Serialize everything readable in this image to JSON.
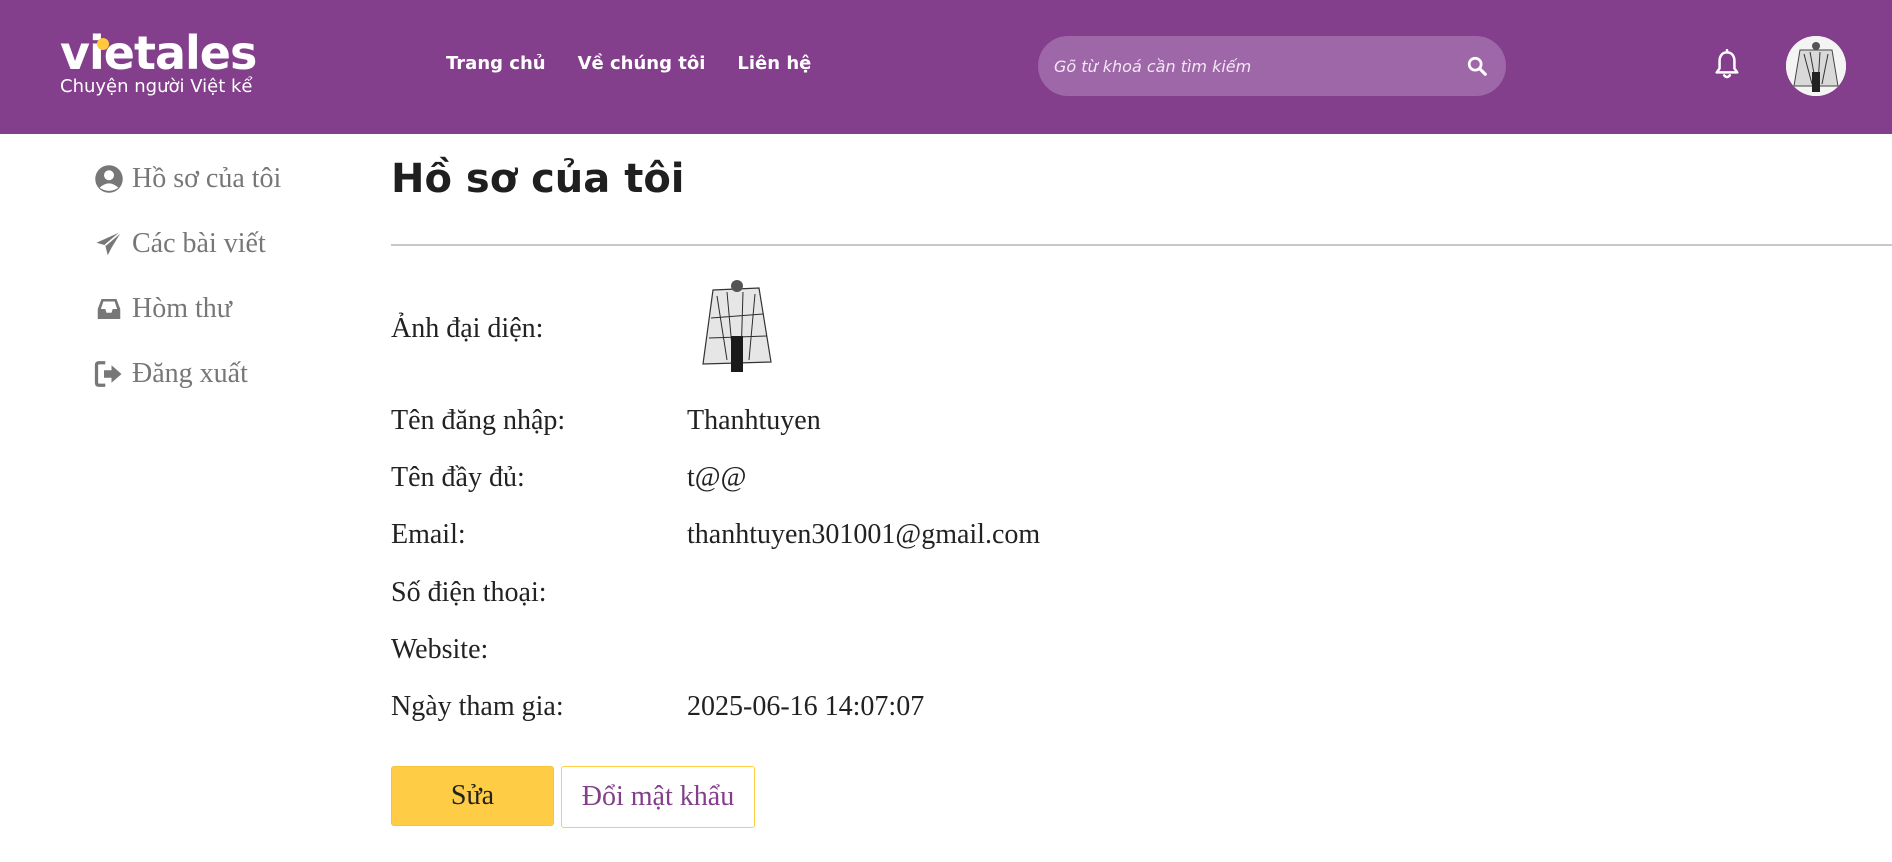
{
  "brand": {
    "logo_text": "vietales",
    "tagline": "Chuyện người Việt kể",
    "accent": "#843f8c",
    "logo_dot": "#ffc93c"
  },
  "nav": [
    {
      "label": "Trang chủ"
    },
    {
      "label": "Về chúng tôi"
    },
    {
      "label": "Liên hệ"
    }
  ],
  "search": {
    "placeholder": "Gõ từ khoá cần tìm kiếm",
    "icon": "search-icon"
  },
  "header_icons": {
    "bell": "bell-icon",
    "avatar": "avatar"
  },
  "sidebar": {
    "items": [
      {
        "label": "Hồ sơ của tôi",
        "icon": "user-circle-icon"
      },
      {
        "label": "Các bài viết",
        "icon": "paper-plane-icon"
      },
      {
        "label": "Hòm thư",
        "icon": "inbox-icon"
      },
      {
        "label": "Đăng xuất",
        "icon": "sign-out-icon"
      }
    ]
  },
  "profile": {
    "title": "Hồ sơ của tôi",
    "fields": {
      "avatar_label": "Ảnh đại diện:",
      "username_label": "Tên đăng nhập:",
      "username": "Thanhtuyen",
      "fullname_label": "Tên đầy đủ:",
      "fullname": "t@@",
      "email_label": "Email:",
      "email": "thanhtuyen301001@gmail.com",
      "phone_label": "Số điện thoại:",
      "phone": "",
      "website_label": "Website:",
      "website": "",
      "joined_label": "Ngày tham gia:",
      "joined": "2025-06-16 14:07:07"
    },
    "buttons": {
      "edit": "Sửa",
      "change_password": "Đổi mật khẩu"
    },
    "button_color": "#ffcd45"
  }
}
